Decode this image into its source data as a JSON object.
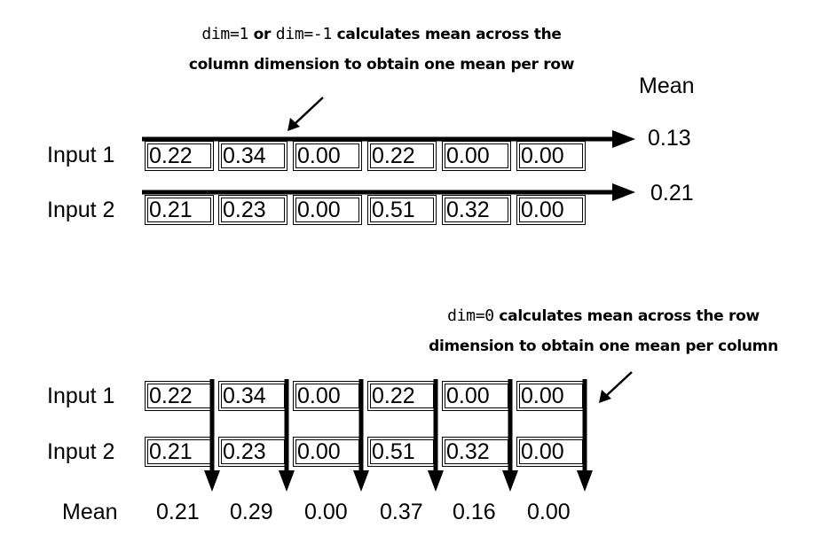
{
  "top": {
    "annotation": {
      "code1": "dim=1",
      "or": "or",
      "code2": "dim=-1",
      "line1_rest": "calculates mean across the",
      "line2": "column dimension to obtain one mean per row"
    },
    "mean_header": "Mean",
    "rows": [
      {
        "label": "Input 1",
        "values": [
          "0.22",
          "0.34",
          "0.00",
          "0.22",
          "0.00",
          "0.00"
        ],
        "mean": "0.13"
      },
      {
        "label": "Input 2",
        "values": [
          "0.21",
          "0.23",
          "0.00",
          "0.51",
          "0.32",
          "0.00"
        ],
        "mean": "0.21"
      }
    ]
  },
  "bottom": {
    "annotation": {
      "code": "dim=0",
      "line1_rest": "calculates mean across the row",
      "line2": "dimension to obtain one mean per column"
    },
    "rows": [
      {
        "label": "Input 1",
        "values": [
          "0.22",
          "0.34",
          "0.00",
          "0.22",
          "0.00",
          "0.00"
        ]
      },
      {
        "label": "Input 2",
        "values": [
          "0.21",
          "0.23",
          "0.00",
          "0.51",
          "0.32",
          "0.00"
        ]
      }
    ],
    "mean_label": "Mean",
    "means": [
      "0.21",
      "0.29",
      "0.00",
      "0.37",
      "0.16",
      "0.00"
    ]
  }
}
